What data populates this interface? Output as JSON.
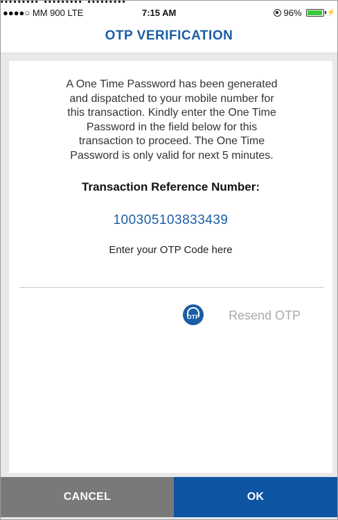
{
  "top_strip": {
    "cropped_text": "mmm mmm mmm"
  },
  "status_bar": {
    "carrier": "●●●●○ MM 900  LTE",
    "time": "7:15 AM",
    "battery_percent": "96%",
    "battery_level": 0.96,
    "battery_color": "#38c93c"
  },
  "header": {
    "title": "OTP VERIFICATION",
    "title_color": "#1a5da6"
  },
  "content": {
    "message_lines": [
      "A One Time Password has been generated",
      "and dispatched to your mobile number for",
      "this transaction. Kindly enter the One Time",
      "Password in the field below for this",
      "transaction to proceed.  The One Time",
      "Password is only valid for next 5 minutes."
    ],
    "reference_label": "Transaction Reference Number:",
    "reference_number": "100305103833439",
    "otp_prompt": "Enter your OTP Code here",
    "otp_value": "",
    "otp_badge_text": "OTP",
    "resend_label": "Resend OTP"
  },
  "footer": {
    "cancel_label": "CANCEL",
    "ok_label": "OK",
    "cancel_color": "#797979",
    "ok_color": "#0d55a3"
  },
  "icons": {
    "lock": "lock-icon",
    "battery": "battery-icon",
    "charge": "charge-icon",
    "otp": "otp-icon"
  }
}
